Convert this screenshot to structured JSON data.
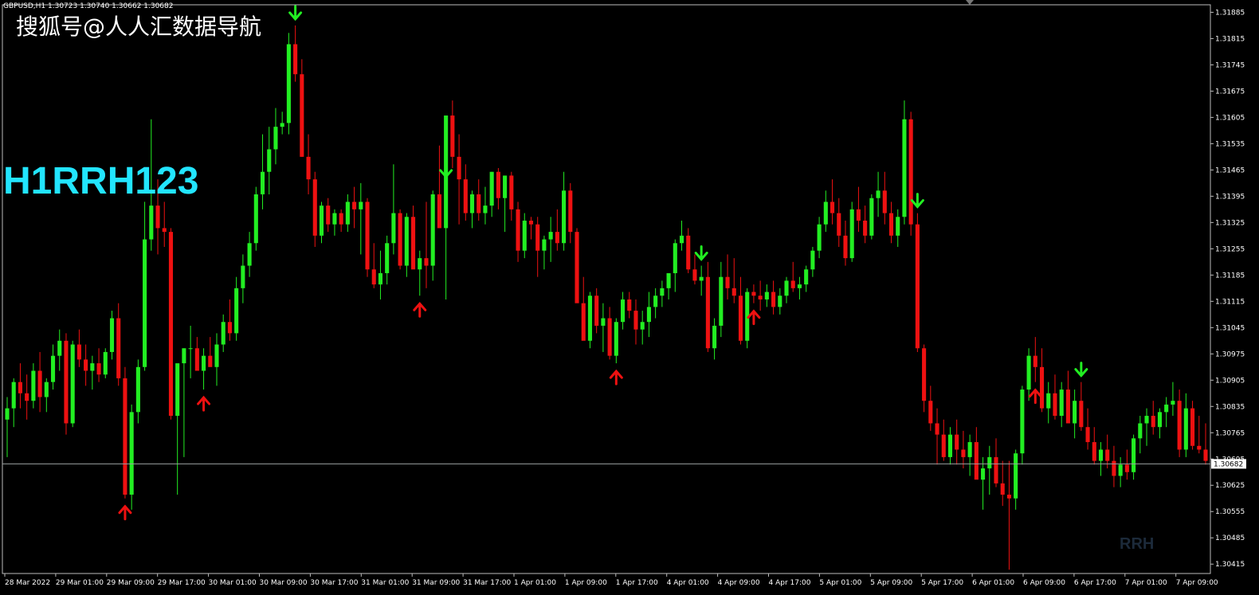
{
  "header": {
    "symbol_text": "GBPUSD,H1  1.30723 1.30740 1.30662 1.30682"
  },
  "overlay": {
    "source_text": "搜狐号@人人汇数据导航",
    "code_text": "H1RRH123",
    "watermark_text": "RRH"
  },
  "colors": {
    "background": "#000000",
    "bull": "#22ee22",
    "bear": "#ee1111",
    "axis": "#bbbbbb",
    "price_line": "#9aa0a0",
    "code_text": "#22e5ff"
  },
  "chart_data": {
    "type": "candlestick",
    "symbol": "GBPUSD",
    "timeframe": "H1",
    "current_price": "1.30682",
    "y_range": [
      1.3039,
      1.31905
    ],
    "y_ticks": [
      "1.31885",
      "1.31815",
      "1.31745",
      "1.31675",
      "1.31605",
      "1.31535",
      "1.31465",
      "1.31395",
      "1.31325",
      "1.31255",
      "1.31185",
      "1.31115",
      "1.31045",
      "1.30975",
      "1.30905",
      "1.30835",
      "1.30765",
      "1.30695",
      "1.30625",
      "1.30555",
      "1.30485",
      "1.30415"
    ],
    "x_labels": [
      "28 Mar 2022",
      "29 Mar 01:00",
      "29 Mar 09:00",
      "29 Mar 17:00",
      "30 Mar 01:00",
      "30 Mar 09:00",
      "30 Mar 17:00",
      "31 Mar 01:00",
      "31 Mar 09:00",
      "31 Mar 17:00",
      "1 Apr 01:00",
      "1 Apr 09:00",
      "1 Apr 17:00",
      "4 Apr 01:00",
      "4 Apr 09:00",
      "4 Apr 17:00",
      "5 Apr 01:00",
      "5 Apr 09:00",
      "5 Apr 17:00",
      "6 Apr 01:00",
      "6 Apr 09:00",
      "6 Apr 17:00",
      "7 Apr 01:00",
      "7 Apr 09:00"
    ],
    "candles": [
      [
        1.308,
        1.3086,
        1.307,
        1.3083
      ],
      [
        1.3083,
        1.3091,
        1.3078,
        1.309
      ],
      [
        1.309,
        1.3095,
        1.3083,
        1.3087
      ],
      [
        1.3087,
        1.3092,
        1.308,
        1.3085
      ],
      [
        1.3085,
        1.3095,
        1.3083,
        1.3093
      ],
      [
        1.3093,
        1.3098,
        1.3082,
        1.3086
      ],
      [
        1.3086,
        1.3091,
        1.3082,
        1.309
      ],
      [
        1.309,
        1.31,
        1.3088,
        1.3097
      ],
      [
        1.3097,
        1.3104,
        1.3093,
        1.3101
      ],
      [
        1.3101,
        1.3103,
        1.3076,
        1.3079
      ],
      [
        1.3079,
        1.3101,
        1.3078,
        1.31
      ],
      [
        1.31,
        1.3104,
        1.3094,
        1.3096
      ],
      [
        1.3096,
        1.31,
        1.3089,
        1.3093
      ],
      [
        1.3093,
        1.3097,
        1.3088,
        1.3095
      ],
      [
        1.3095,
        1.3099,
        1.309,
        1.3092
      ],
      [
        1.3092,
        1.3099,
        1.3091,
        1.3098
      ],
      [
        1.3098,
        1.3109,
        1.3096,
        1.3107
      ],
      [
        1.3107,
        1.3111,
        1.3089,
        1.3091
      ],
      [
        1.3091,
        1.3094,
        1.3059,
        1.306
      ],
      [
        1.306,
        1.3084,
        1.3056,
        1.3082
      ],
      [
        1.3082,
        1.3096,
        1.3079,
        1.3094
      ],
      [
        1.3094,
        1.3138,
        1.3093,
        1.3128
      ],
      [
        1.3128,
        1.316,
        1.3125,
        1.3137
      ],
      [
        1.3137,
        1.3144,
        1.3124,
        1.3131
      ],
      [
        1.3131,
        1.3138,
        1.3126,
        1.313
      ],
      [
        1.313,
        1.3131,
        1.308,
        1.3081
      ],
      [
        1.3081,
        1.3094,
        1.306,
        1.3095
      ],
      [
        1.3095,
        1.3099,
        1.307,
        1.3099
      ],
      [
        1.3099,
        1.3105,
        1.3091,
        1.3099
      ],
      [
        1.3099,
        1.3102,
        1.3095,
        1.3093
      ],
      [
        1.3093,
        1.3099,
        1.3088,
        1.3097
      ],
      [
        1.3097,
        1.3102,
        1.3095,
        1.3094
      ],
      [
        1.3094,
        1.3103,
        1.3089,
        1.31
      ],
      [
        1.31,
        1.3108,
        1.3098,
        1.3106
      ],
      [
        1.3106,
        1.3112,
        1.3101,
        1.3103
      ],
      [
        1.3103,
        1.3118,
        1.3101,
        1.3115
      ],
      [
        1.3115,
        1.3124,
        1.3111,
        1.3121
      ],
      [
        1.3121,
        1.313,
        1.3118,
        1.3127
      ],
      [
        1.3127,
        1.3142,
        1.3125,
        1.314
      ],
      [
        1.314,
        1.3156,
        1.3136,
        1.3146
      ],
      [
        1.3146,
        1.3158,
        1.314,
        1.3152
      ],
      [
        1.3152,
        1.3163,
        1.3148,
        1.3158
      ],
      [
        1.3158,
        1.3162,
        1.3156,
        1.3159
      ],
      [
        1.3159,
        1.3183,
        1.3156,
        1.318
      ],
      [
        1.318,
        1.3185,
        1.317,
        1.3172
      ],
      [
        1.3172,
        1.3176,
        1.315,
        1.315
      ],
      [
        1.315,
        1.3156,
        1.314,
        1.3144
      ],
      [
        1.3144,
        1.3146,
        1.3126,
        1.3129
      ],
      [
        1.3129,
        1.3138,
        1.3127,
        1.3137
      ],
      [
        1.3137,
        1.3139,
        1.313,
        1.3132
      ],
      [
        1.3132,
        1.3136,
        1.3129,
        1.3135
      ],
      [
        1.3135,
        1.3136,
        1.313,
        1.3132
      ],
      [
        1.3132,
        1.314,
        1.313,
        1.3138
      ],
      [
        1.3138,
        1.3142,
        1.3131,
        1.3136
      ],
      [
        1.3136,
        1.3143,
        1.3124,
        1.3138
      ],
      [
        1.3138,
        1.3139,
        1.3118,
        1.312
      ],
      [
        1.312,
        1.3127,
        1.3115,
        1.3116
      ],
      [
        1.3116,
        1.3125,
        1.3112,
        1.3119
      ],
      [
        1.3119,
        1.3129,
        1.3116,
        1.3127
      ],
      [
        1.3127,
        1.3148,
        1.3124,
        1.3135
      ],
      [
        1.3135,
        1.3136,
        1.312,
        1.3121
      ],
      [
        1.3121,
        1.3135,
        1.3118,
        1.3134
      ],
      [
        1.3134,
        1.3137,
        1.3122,
        1.312
      ],
      [
        1.312,
        1.3125,
        1.3113,
        1.3123
      ],
      [
        1.3123,
        1.3138,
        1.3115,
        1.3121
      ],
      [
        1.3121,
        1.3141,
        1.3117,
        1.314
      ],
      [
        1.314,
        1.3153,
        1.3138,
        1.3131
      ],
      [
        1.3131,
        1.3143,
        1.3112,
        1.3161
      ],
      [
        1.3161,
        1.3165,
        1.3147,
        1.315
      ],
      [
        1.315,
        1.3156,
        1.3132,
        1.3144
      ],
      [
        1.3144,
        1.3148,
        1.3133,
        1.3135
      ],
      [
        1.3135,
        1.3141,
        1.3131,
        1.314
      ],
      [
        1.314,
        1.3144,
        1.3133,
        1.3135
      ],
      [
        1.3135,
        1.3142,
        1.3132,
        1.3137
      ],
      [
        1.3137,
        1.3146,
        1.3134,
        1.3146
      ],
      [
        1.3146,
        1.3147,
        1.3136,
        1.3139
      ],
      [
        1.3139,
        1.3145,
        1.313,
        1.3145
      ],
      [
        1.3145,
        1.3146,
        1.3133,
        1.3136
      ],
      [
        1.3136,
        1.3138,
        1.3122,
        1.3125
      ],
      [
        1.3125,
        1.3135,
        1.3123,
        1.3133
      ],
      [
        1.3133,
        1.3134,
        1.3128,
        1.3132
      ],
      [
        1.3132,
        1.3134,
        1.3118,
        1.3125
      ],
      [
        1.3125,
        1.3129,
        1.312,
        1.3128
      ],
      [
        1.3128,
        1.3134,
        1.3122,
        1.313
      ],
      [
        1.313,
        1.3136,
        1.3125,
        1.3127
      ],
      [
        1.3127,
        1.3146,
        1.3125,
        1.3141
      ],
      [
        1.3141,
        1.3143,
        1.3127,
        1.313
      ],
      [
        1.313,
        1.3131,
        1.3112,
        1.3111
      ],
      [
        1.3111,
        1.3118,
        1.3102,
        1.3101
      ],
      [
        1.3101,
        1.3114,
        1.3099,
        1.3113
      ],
      [
        1.3113,
        1.3115,
        1.3103,
        1.3105
      ],
      [
        1.3105,
        1.3111,
        1.3098,
        1.3107
      ],
      [
        1.3107,
        1.311,
        1.3096,
        1.3097
      ],
      [
        1.3097,
        1.3107,
        1.3095,
        1.3106
      ],
      [
        1.3106,
        1.3114,
        1.3104,
        1.3112
      ],
      [
        1.3112,
        1.3114,
        1.3107,
        1.3109
      ],
      [
        1.3109,
        1.3112,
        1.31,
        1.3104
      ],
      [
        1.3104,
        1.3109,
        1.31,
        1.3106
      ],
      [
        1.3106,
        1.3114,
        1.3102,
        1.311
      ],
      [
        1.311,
        1.3115,
        1.3107,
        1.3113
      ],
      [
        1.3113,
        1.3117,
        1.311,
        1.3115
      ],
      [
        1.3115,
        1.3119,
        1.3112,
        1.3119
      ],
      [
        1.3119,
        1.3128,
        1.3114,
        1.3127
      ],
      [
        1.3127,
        1.3133,
        1.3125,
        1.3129
      ],
      [
        1.3129,
        1.3131,
        1.3119,
        1.312
      ],
      [
        1.312,
        1.3124,
        1.3116,
        1.3117
      ],
      [
        1.3117,
        1.3121,
        1.3113,
        1.3118
      ],
      [
        1.3118,
        1.3122,
        1.3098,
        1.3099
      ],
      [
        1.3099,
        1.3107,
        1.3096,
        1.3105
      ],
      [
        1.3105,
        1.3122,
        1.3102,
        1.3118
      ],
      [
        1.3118,
        1.3124,
        1.3112,
        1.3115
      ],
      [
        1.3115,
        1.3123,
        1.3111,
        1.3113
      ],
      [
        1.3113,
        1.3118,
        1.31,
        1.3101
      ],
      [
        1.3101,
        1.3115,
        1.3099,
        1.3114
      ],
      [
        1.3114,
        1.3116,
        1.3111,
        1.3113
      ],
      [
        1.3113,
        1.3117,
        1.3109,
        1.3112
      ],
      [
        1.3112,
        1.3116,
        1.311,
        1.3114
      ],
      [
        1.3114,
        1.3117,
        1.3108,
        1.311
      ],
      [
        1.311,
        1.3115,
        1.3108,
        1.3113
      ],
      [
        1.3113,
        1.3118,
        1.3111,
        1.3117
      ],
      [
        1.3117,
        1.3122,
        1.3114,
        1.3115
      ],
      [
        1.3115,
        1.3118,
        1.3112,
        1.3116
      ],
      [
        1.3116,
        1.3121,
        1.3114,
        1.312
      ],
      [
        1.312,
        1.3126,
        1.3118,
        1.3125
      ],
      [
        1.3125,
        1.3134,
        1.3123,
        1.3132
      ],
      [
        1.3132,
        1.3141,
        1.313,
        1.3138
      ],
      [
        1.3138,
        1.3144,
        1.3132,
        1.3135
      ],
      [
        1.3135,
        1.3139,
        1.3126,
        1.3129
      ],
      [
        1.3129,
        1.3133,
        1.3121,
        1.3123
      ],
      [
        1.3123,
        1.3138,
        1.3122,
        1.3136
      ],
      [
        1.3136,
        1.3142,
        1.313,
        1.3133
      ],
      [
        1.3133,
        1.3137,
        1.3127,
        1.3129
      ],
      [
        1.3129,
        1.314,
        1.3128,
        1.3139
      ],
      [
        1.3139,
        1.3146,
        1.3134,
        1.3141
      ],
      [
        1.3141,
        1.3146,
        1.3132,
        1.3135
      ],
      [
        1.3135,
        1.3138,
        1.3127,
        1.3129
      ],
      [
        1.3129,
        1.3136,
        1.3126,
        1.3134
      ],
      [
        1.3134,
        1.3165,
        1.3132,
        1.316
      ],
      [
        1.316,
        1.3162,
        1.3129,
        1.3132
      ],
      [
        1.3132,
        1.3135,
        1.3098,
        1.3099
      ],
      [
        1.3099,
        1.31,
        1.3082,
        1.3085
      ],
      [
        1.3085,
        1.3089,
        1.3077,
        1.3079
      ],
      [
        1.3079,
        1.3083,
        1.3068,
        1.3076
      ],
      [
        1.3076,
        1.308,
        1.3069,
        1.307
      ],
      [
        1.307,
        1.3078,
        1.3068,
        1.3076
      ],
      [
        1.3076,
        1.308,
        1.3068,
        1.3072
      ],
      [
        1.3072,
        1.3077,
        1.3067,
        1.307
      ],
      [
        1.307,
        1.3076,
        1.3065,
        1.3074
      ],
      [
        1.3074,
        1.3078,
        1.3065,
        1.3064
      ],
      [
        1.3064,
        1.307,
        1.3056,
        1.3067
      ],
      [
        1.3067,
        1.3073,
        1.306,
        1.307
      ],
      [
        1.307,
        1.3075,
        1.3062,
        1.3063
      ],
      [
        1.3063,
        1.3069,
        1.3057,
        1.306
      ],
      [
        1.306,
        1.3069,
        1.304,
        1.3059
      ],
      [
        1.3059,
        1.3072,
        1.3056,
        1.3071
      ],
      [
        1.3071,
        1.3089,
        1.3068,
        1.3088
      ],
      [
        1.3088,
        1.3099,
        1.3085,
        1.3097
      ],
      [
        1.3097,
        1.3102,
        1.309,
        1.3094
      ],
      [
        1.3094,
        1.3099,
        1.3082,
        1.3083
      ],
      [
        1.3083,
        1.309,
        1.3079,
        1.3087
      ],
      [
        1.3087,
        1.3092,
        1.308,
        1.3081
      ],
      [
        1.3081,
        1.309,
        1.3078,
        1.3088
      ],
      [
        1.3088,
        1.3093,
        1.3079,
        1.3079
      ],
      [
        1.3079,
        1.3088,
        1.3075,
        1.3085
      ],
      [
        1.3085,
        1.309,
        1.3077,
        1.3078
      ],
      [
        1.3078,
        1.3083,
        1.3072,
        1.3074
      ],
      [
        1.3074,
        1.3078,
        1.3068,
        1.3069
      ],
      [
        1.3069,
        1.3074,
        1.3065,
        1.3072
      ],
      [
        1.3072,
        1.3076,
        1.3067,
        1.3069
      ],
      [
        1.3069,
        1.3073,
        1.3062,
        1.3065
      ],
      [
        1.3065,
        1.307,
        1.3062,
        1.3068
      ],
      [
        1.3068,
        1.3072,
        1.3064,
        1.3066
      ],
      [
        1.3066,
        1.3076,
        1.3064,
        1.3075
      ],
      [
        1.3075,
        1.3081,
        1.3071,
        1.3079
      ],
      [
        1.3079,
        1.3083,
        1.3073,
        1.3081
      ],
      [
        1.3081,
        1.3085,
        1.3076,
        1.3078
      ],
      [
        1.3078,
        1.3083,
        1.3075,
        1.3082
      ],
      [
        1.3082,
        1.3086,
        1.3078,
        1.3084
      ],
      [
        1.3084,
        1.309,
        1.3081,
        1.3085
      ],
      [
        1.3085,
        1.3088,
        1.307,
        1.3072
      ],
      [
        1.3072,
        1.3087,
        1.307,
        1.3083
      ],
      [
        1.3083,
        1.3085,
        1.3072,
        1.3073
      ],
      [
        1.3073,
        1.3081,
        1.3071,
        1.3072
      ],
      [
        1.3072,
        1.3079,
        1.3068,
        1.3069
      ]
    ],
    "signals": [
      {
        "type": "sell",
        "candle_index": 44
      },
      {
        "type": "sell",
        "candle_index": 67
      },
      {
        "type": "sell",
        "candle_index": 106
      },
      {
        "type": "sell",
        "candle_index": 139
      },
      {
        "type": "sell",
        "candle_index": 164
      },
      {
        "type": "buy",
        "candle_index": 18
      },
      {
        "type": "buy",
        "candle_index": 30
      },
      {
        "type": "buy",
        "candle_index": 63
      },
      {
        "type": "buy",
        "candle_index": 93
      },
      {
        "type": "buy",
        "candle_index": 114
      },
      {
        "type": "buy",
        "candle_index": 157
      }
    ]
  }
}
